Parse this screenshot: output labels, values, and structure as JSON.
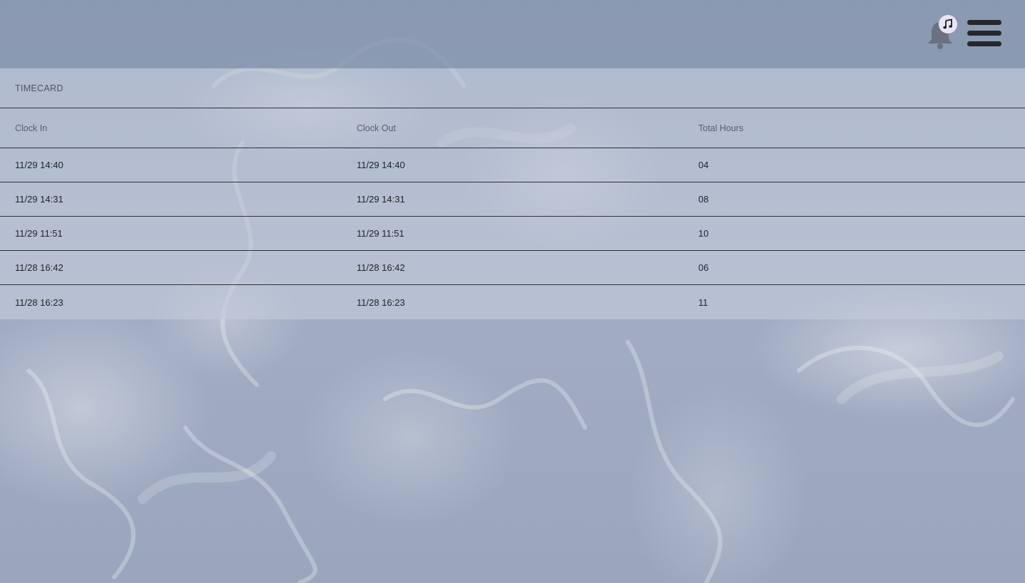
{
  "header": {
    "notification_icon": "bell-icon",
    "badge_icon": "music-note-icon",
    "menu_icon": "hamburger-menu-icon"
  },
  "timecard": {
    "title": "TIMECARD",
    "columns": [
      "Clock In",
      "Clock Out",
      "Total Hours"
    ],
    "rows": [
      {
        "clock_in": "11/29 14:40",
        "clock_out": "11/29 14:40",
        "total_hours": "04"
      },
      {
        "clock_in": "11/29 14:31",
        "clock_out": "11/29 14:31",
        "total_hours": "08"
      },
      {
        "clock_in": "11/29 11:51",
        "clock_out": "11/29 11:51",
        "total_hours": "10"
      },
      {
        "clock_in": "11/28 16:42",
        "clock_out": "11/28 16:42",
        "total_hours": "06"
      },
      {
        "clock_in": "11/28 16:23",
        "clock_out": "11/28 16:23",
        "total_hours": "11"
      }
    ]
  },
  "colors": {
    "topbar": "#8a98b2",
    "panel": "#c4cbdb",
    "divider": "#2d313a",
    "menu": "#25272c",
    "badge": "#e9e4f4"
  }
}
